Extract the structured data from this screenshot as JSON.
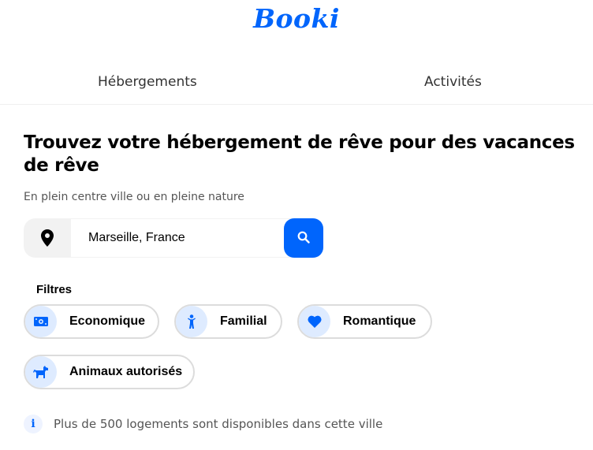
{
  "header": {
    "logo": "Booki"
  },
  "nav": {
    "items": [
      {
        "label": "Hébergements"
      },
      {
        "label": "Activités"
      }
    ]
  },
  "hero": {
    "title": "Trouvez votre hébergement de rêve pour des vacances de rêve",
    "subtitle": "En plein centre ville ou en pleine nature"
  },
  "search": {
    "value": "Marseille, France",
    "location_icon": "map-pin-icon",
    "button_icon": "search-icon"
  },
  "filters": {
    "label": "Filtres",
    "items": [
      {
        "label": "Economique",
        "icon": "money-icon"
      },
      {
        "label": "Familial",
        "icon": "child-icon"
      },
      {
        "label": "Romantique",
        "icon": "heart-icon"
      },
      {
        "label": "Animaux autorisés",
        "icon": "dog-icon"
      }
    ]
  },
  "info": {
    "icon": "info-icon",
    "text": "Plus de 500 logements sont disponibles dans cette ville"
  },
  "colors": {
    "accent": "#0065FC",
    "chip_icon_bg": "#DEEBFF",
    "chip_border": "#dcdcdc"
  }
}
